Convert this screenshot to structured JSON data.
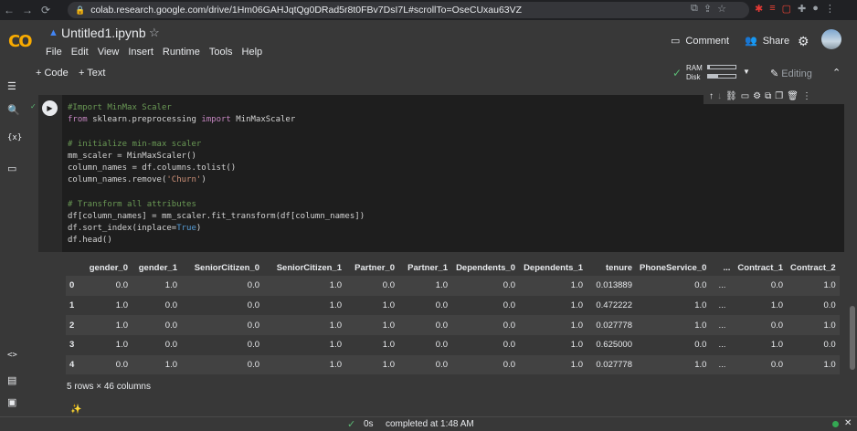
{
  "browser": {
    "url": "colab.research.google.com/drive/1Hm06GAHJqtQg0DRad5r8t0FBv7DsI7L#scrollTo=OseCUxau63VZ"
  },
  "header": {
    "title": "Untitled1.ipynb",
    "menu": [
      "File",
      "Edit",
      "View",
      "Insert",
      "Runtime",
      "Tools",
      "Help"
    ],
    "comment": "Comment",
    "share": "Share"
  },
  "toolbar": {
    "add_code": "+ Code",
    "add_text": "+ Text",
    "ram": "RAM",
    "disk": "Disk",
    "editing": "Editing",
    "ram_used": 0.08,
    "disk_used": 0.35
  },
  "cell": {
    "code_lines": [
      [
        "cm",
        "#Import MinMax Scaler"
      ],
      [
        "mix",
        "from|sklearn.preprocessing|import|MinMaxScaler"
      ],
      [
        "",
        ""
      ],
      [
        "cm",
        "# initialize min-max scaler"
      ],
      [
        "",
        "mm_scaler = MinMaxScaler()"
      ],
      [
        "",
        "column_names = df.columns.tolist()"
      ],
      [
        "str",
        "column_names.remove(|'Churn'|)"
      ],
      [
        "",
        ""
      ],
      [
        "cm",
        "# Transform all attributes"
      ],
      [
        "",
        "df[column_names] = mm_scaler.fit_transform(df[column_names])"
      ],
      [
        "bool",
        "df.sort_index(inplace=|True|)"
      ],
      [
        "",
        "df.head()"
      ]
    ]
  },
  "output": {
    "columns": [
      "",
      "gender_0",
      "gender_1",
      "SeniorCitizen_0",
      "SeniorCitizen_1",
      "Partner_0",
      "Partner_1",
      "Dependents_0",
      "Dependents_1",
      "tenure",
      "PhoneService_0",
      "...",
      "Contract_1",
      "Contract_2"
    ],
    "rows": [
      [
        "0",
        "0.0",
        "1.0",
        "0.0",
        "1.0",
        "0.0",
        "1.0",
        "0.0",
        "1.0",
        "0.013889",
        "0.0",
        "...",
        "0.0",
        "1.0"
      ],
      [
        "1",
        "1.0",
        "0.0",
        "0.0",
        "1.0",
        "1.0",
        "0.0",
        "0.0",
        "1.0",
        "0.472222",
        "1.0",
        "...",
        "1.0",
        "0.0"
      ],
      [
        "2",
        "1.0",
        "0.0",
        "0.0",
        "1.0",
        "1.0",
        "0.0",
        "0.0",
        "1.0",
        "0.027778",
        "1.0",
        "...",
        "0.0",
        "1.0"
      ],
      [
        "3",
        "1.0",
        "0.0",
        "0.0",
        "1.0",
        "1.0",
        "0.0",
        "0.0",
        "1.0",
        "0.625000",
        "0.0",
        "...",
        "1.0",
        "0.0"
      ],
      [
        "4",
        "0.0",
        "1.0",
        "0.0",
        "1.0",
        "1.0",
        "0.0",
        "0.0",
        "1.0",
        "0.027778",
        "1.0",
        "...",
        "0.0",
        "1.0"
      ]
    ],
    "summary": "5 rows × 46 columns"
  },
  "status": {
    "time": "0s",
    "text": "completed at 1:48 AM"
  }
}
